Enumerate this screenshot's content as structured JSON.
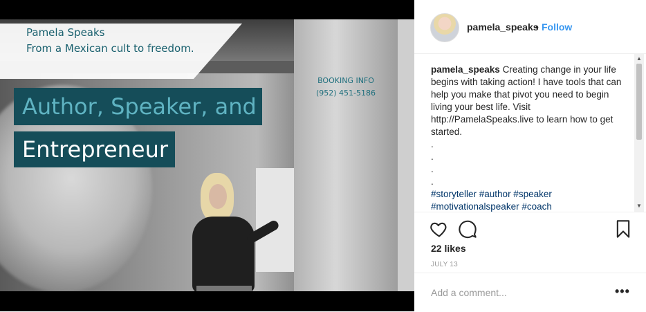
{
  "overlay": {
    "title_line1": "Pamela Speaks",
    "title_line2": "From a Mexican cult to freedom.",
    "booking_label": "BOOKING INFO",
    "booking_phone": "(952) 451-5186",
    "banner_line1": "Author, Speaker, and",
    "banner_line2": "Entrepreneur"
  },
  "header": {
    "username": "pamela_speaks",
    "separator": "•",
    "follow_label": "Follow"
  },
  "caption": {
    "username": "pamela_speaks",
    "text": "Creating change in your life begins with taking action! I have tools that can help you make that pivot you need to begin living your best life. Visit http://PamelaSpeaks.live to learn how to get started.",
    "dots": [
      ".",
      ".",
      ".",
      "."
    ],
    "hashtags_line1": "#storyteller #author #speaker",
    "hashtags_line2": "#motivationalspeaker #coach"
  },
  "actions": {
    "likes": "22 likes",
    "date": "JULY 13"
  },
  "comment_box": {
    "placeholder": "Add a comment...",
    "more": "•••"
  },
  "icons": {
    "like": "heart-icon",
    "comment": "speech-bubble-icon",
    "save": "bookmark-icon"
  },
  "colors": {
    "follow": "#3897f0",
    "banner": "#154d59",
    "banner_text": "#5fb3c2"
  }
}
